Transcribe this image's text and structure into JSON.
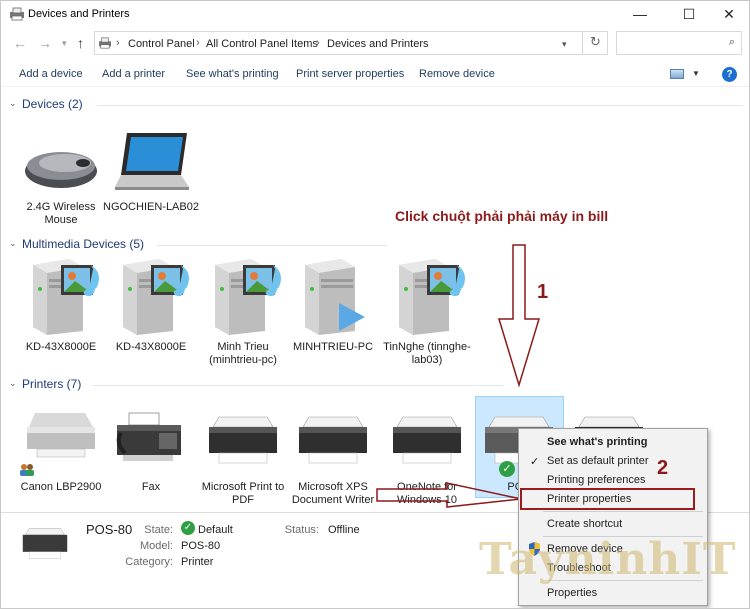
{
  "window": {
    "title": "Devices and Printers",
    "controls": {
      "minimize": "—",
      "maximize": "☐",
      "close": "✕"
    }
  },
  "address": {
    "breadcrumbs": [
      "Control Panel",
      "All Control Panel Items",
      "Devices and Printers"
    ],
    "refresh_glyph": "↻",
    "search_placeholder": ""
  },
  "toolbar": {
    "commands": [
      "Add a device",
      "Add a printer",
      "See what's printing",
      "Print server properties",
      "Remove device"
    ],
    "help_label": "?"
  },
  "groups": [
    {
      "title": "Devices (2)",
      "items": [
        {
          "name": "2.4G Wireless Mouse",
          "icon": "mouse-icon"
        },
        {
          "name": "NGOCHIEN-LAB02",
          "icon": "laptop-icon"
        }
      ]
    },
    {
      "title": "Multimedia Devices (5)",
      "items": [
        {
          "name": "KD-43X8000E",
          "icon": "media-server-icon"
        },
        {
          "name": "KD-43X8000E",
          "icon": "media-server-icon"
        },
        {
          "name": "Minh Trieu (minhtrieu-pc)",
          "icon": "media-server-icon"
        },
        {
          "name": "MINHTRIEU-PC",
          "icon": "media-play-server-icon"
        },
        {
          "name": "TinNghe (tinnghe-lab03)",
          "icon": "media-server-icon"
        }
      ]
    },
    {
      "title": "Printers (7)",
      "items": [
        {
          "name": "Canon LBP2900",
          "icon": "printer-icon"
        },
        {
          "name": "Fax",
          "icon": "fax-icon"
        },
        {
          "name": "Microsoft Print to PDF",
          "icon": "printer-icon"
        },
        {
          "name": "Microsoft XPS Document Writer",
          "icon": "printer-icon"
        },
        {
          "name": "OneNote for Windows 10",
          "icon": "printer-icon"
        },
        {
          "name": "POS",
          "icon": "printer-icon",
          "selected": true,
          "default": true
        }
      ]
    }
  ],
  "details": {
    "name": "POS-80",
    "state_label": "State:",
    "state_value": "Default",
    "model_label": "Model:",
    "model_value": "POS-80",
    "category_label": "Category:",
    "category_value": "Printer",
    "status_label": "Status:",
    "status_value": "Offline"
  },
  "context_menu": {
    "items": [
      {
        "label": "See what's printing",
        "bold": true
      },
      {
        "label": "Set as default printer",
        "checked": true
      },
      {
        "label": "Printing preferences"
      },
      {
        "label": "Printer properties",
        "highlighted": true
      },
      {
        "label": "Create shortcut"
      },
      {
        "label": "Remove device",
        "shield": true
      },
      {
        "label": "Troubleshoot"
      },
      {
        "label": "Properties"
      }
    ]
  },
  "annotations": {
    "instruction": "Click chuột phải phải máy in bill",
    "step1": "1",
    "step2": "2",
    "watermark": "TayninhIT"
  },
  "colors": {
    "annotation": "#8b1a1a",
    "group_header": "#1e3a78",
    "selection": "#cce8ff",
    "default_badge": "#2ea043"
  }
}
